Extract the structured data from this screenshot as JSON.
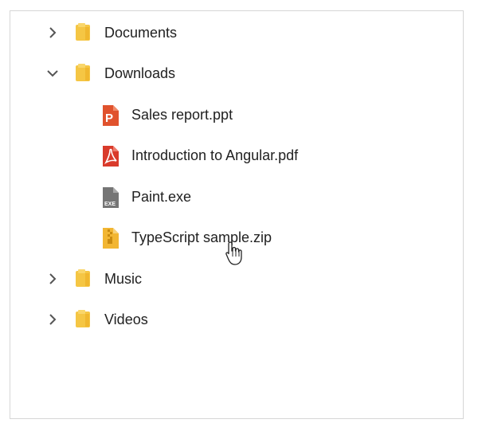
{
  "tree": {
    "items": [
      {
        "label": "Documents",
        "icon": "folder-icon",
        "state": "collapsed"
      },
      {
        "label": "Downloads",
        "icon": "folder-icon",
        "state": "expanded",
        "children": [
          {
            "label": "Sales report.ppt",
            "icon": "ppt-file-icon"
          },
          {
            "label": "Introduction to Angular.pdf",
            "icon": "pdf-file-icon"
          },
          {
            "label": "Paint.exe",
            "icon": "exe-file-icon"
          },
          {
            "label": "TypeScript sample.zip",
            "icon": "zip-file-icon"
          }
        ]
      },
      {
        "label": "Music",
        "icon": "folder-icon",
        "state": "collapsed"
      },
      {
        "label": "Videos",
        "icon": "folder-icon",
        "state": "collapsed"
      }
    ]
  },
  "colors": {
    "folder": "#f5c644",
    "ppt": "#e0522d",
    "pdf": "#d93a2b",
    "exe": "#757575",
    "zip": "#f2b632"
  }
}
